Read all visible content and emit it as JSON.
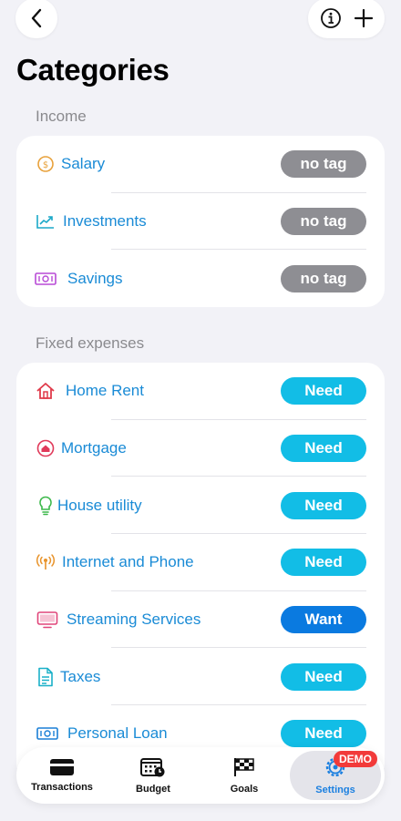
{
  "header": {
    "title": "Categories"
  },
  "sections": [
    {
      "title": "Income",
      "items": [
        {
          "label": "Salary",
          "icon": "dollar-coin-icon",
          "tag": "no tag",
          "tag_type": "none"
        },
        {
          "label": "Investments",
          "icon": "chart-trend-icon",
          "tag": "no tag",
          "tag_type": "none"
        },
        {
          "label": "Savings",
          "icon": "banknote-icon",
          "tag": "no tag",
          "tag_type": "none"
        }
      ]
    },
    {
      "title": "Fixed expenses",
      "items": [
        {
          "label": "Home Rent",
          "icon": "house-icon",
          "tag": "Need",
          "tag_type": "need"
        },
        {
          "label": "Mortgage",
          "icon": "house-circle-icon",
          "tag": "Need",
          "tag_type": "need"
        },
        {
          "label": "House utility",
          "icon": "lightbulb-icon",
          "tag": "Need",
          "tag_type": "need"
        },
        {
          "label": "Internet and Phone",
          "icon": "antenna-icon",
          "tag": "Need",
          "tag_type": "need"
        },
        {
          "label": "Streaming Services",
          "icon": "tv-icon",
          "tag": "Want",
          "tag_type": "want"
        },
        {
          "label": "Taxes",
          "icon": "document-icon",
          "tag": "Need",
          "tag_type": "need"
        },
        {
          "label": "Personal Loan",
          "icon": "banknote-icon",
          "tag": "Need",
          "tag_type": "need"
        }
      ]
    }
  ],
  "tabbar": {
    "tabs": [
      {
        "label": "Transactions",
        "icon": "credit-card-icon"
      },
      {
        "label": "Budget",
        "icon": "calendar-clock-icon"
      },
      {
        "label": "Goals",
        "icon": "checkered-flag-icon"
      },
      {
        "label": "Settings",
        "icon": "gear-icon",
        "active": true
      }
    ],
    "badge": "DEMO"
  },
  "colors": {
    "accent_text": "#1a8bd6",
    "tag_none": "#8e8e93",
    "tag_need": "#12bde6",
    "tag_want": "#0a7ae0",
    "demo_badge": "#f23a3a"
  }
}
